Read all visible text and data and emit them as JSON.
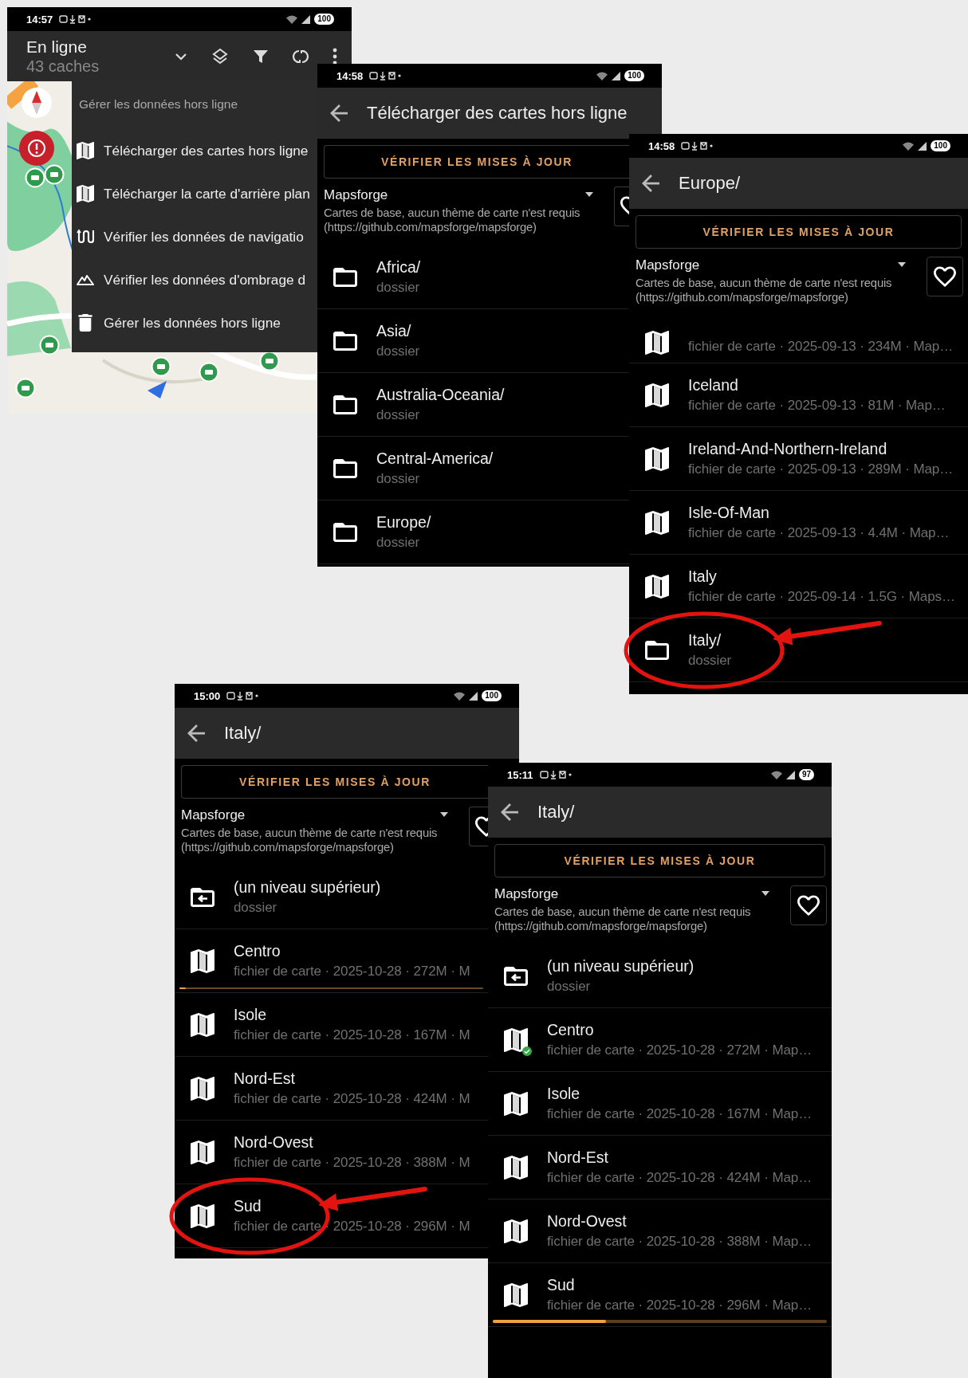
{
  "screens": [
    {
      "kind": "map_menu",
      "status": {
        "time": "14:57",
        "battery": "100"
      },
      "title": "En ligne",
      "subtitle": "43 caches",
      "menu": {
        "header": "Gérer les données hors ligne",
        "items": [
          {
            "kind": "map",
            "label": "Télécharger des cartes hors ligne"
          },
          {
            "kind": "map",
            "label": "Télécharger la carte d'arrière plan"
          },
          {
            "kind": "route",
            "label": "Vérifier les données de navigatio"
          },
          {
            "kind": "mountain",
            "label": "Vérifier les données d'ombrage d"
          },
          {
            "kind": "trash",
            "label": "Gérer les données hors ligne"
          }
        ]
      }
    },
    {
      "kind": "file_list",
      "status": {
        "time": "14:58",
        "battery": "100"
      },
      "title": "Télécharger des cartes hors ligne",
      "update_button": "VÉRIFIER LES MISES À JOUR",
      "source": {
        "name": "Mapsforge",
        "description": "Cartes de base, aucun thème de carte n'est requis",
        "url": "(https://github.com/mapsforge/mapsforge)"
      },
      "items": [
        {
          "kind": "folder",
          "name": "Africa/",
          "detail": "dossier",
          "downloaded": false,
          "circled": false
        },
        {
          "kind": "folder",
          "name": "Asia/",
          "detail": "dossier",
          "downloaded": false,
          "circled": false
        },
        {
          "kind": "folder",
          "name": "Australia-Oceania/",
          "detail": "dossier",
          "downloaded": false,
          "circled": false
        },
        {
          "kind": "folder",
          "name": "Central-America/",
          "detail": "dossier",
          "downloaded": false,
          "circled": false
        },
        {
          "kind": "folder",
          "name": "Europe/",
          "detail": "dossier",
          "downloaded": false,
          "circled": false
        }
      ]
    },
    {
      "kind": "file_list",
      "status": {
        "time": "14:58",
        "battery": "100"
      },
      "title": "Europe/",
      "update_button": "VÉRIFIER LES MISES À JOUR",
      "source": {
        "name": "Mapsforge",
        "description": "Cartes de base, aucun thème de carte n'est requis",
        "url": "(https://github.com/mapsforge/mapsforge)"
      },
      "items": [
        {
          "kind": "map",
          "detail": "fichier de carte · 2025-09-13 · 234M · Map…",
          "downloaded": false,
          "circled": false
        },
        {
          "kind": "map",
          "name": "Iceland",
          "detail": "fichier de carte · 2025-09-13 · 81M · Map…",
          "downloaded": false,
          "circled": false
        },
        {
          "kind": "map",
          "name": "Ireland-And-Northern-Ireland",
          "detail": "fichier de carte · 2025-09-13 · 289M · Map…",
          "downloaded": false,
          "circled": false
        },
        {
          "kind": "map",
          "name": "Isle-Of-Man",
          "detail": "fichier de carte · 2025-09-13 · 4.4M · Map…",
          "downloaded": false,
          "circled": false
        },
        {
          "kind": "map",
          "name": "Italy",
          "detail": "fichier de carte · 2025-09-14 · 1.5G · Maps…",
          "downloaded": false,
          "circled": false
        },
        {
          "kind": "folder",
          "name": "Italy/",
          "detail": "dossier",
          "downloaded": false,
          "circled": true
        }
      ]
    },
    {
      "kind": "file_list",
      "status": {
        "time": "15:00",
        "battery": "100"
      },
      "title": "Italy/",
      "update_button": "VÉRIFIER LES MISES À JOUR",
      "source": {
        "name": "Mapsforge",
        "description": "Cartes de base, aucun thème de carte n'est requis",
        "url": "(https://github.com/mapsforge/mapsforge)"
      },
      "items": [
        {
          "kind": "parent",
          "name": "(un niveau supérieur)",
          "detail": "dossier",
          "downloaded": false,
          "circled": false
        },
        {
          "kind": "map",
          "name": "Centro",
          "detail": "fichier de carte · 2025-10-28 · 272M · M",
          "downloaded": false,
          "circled": false,
          "level": 0.02
        },
        {
          "kind": "map",
          "name": "Isole",
          "detail": "fichier de carte · 2025-10-28 · 167M · M",
          "downloaded": false,
          "circled": false
        },
        {
          "kind": "map",
          "name": "Nord-Est",
          "detail": "fichier de carte · 2025-10-28 · 424M · M",
          "downloaded": false,
          "circled": false
        },
        {
          "kind": "map",
          "name": "Nord-Ovest",
          "detail": "fichier de carte · 2025-10-28 · 388M · M",
          "downloaded": false,
          "circled": false
        },
        {
          "kind": "map",
          "name": "Sud",
          "detail": "fichier de carte · 2025-10-28 · 296M · M",
          "downloaded": false,
          "circled": true
        }
      ]
    },
    {
      "kind": "file_list",
      "status": {
        "time": "15:11",
        "battery": "97"
      },
      "title": "Italy/",
      "update_button": "VÉRIFIER LES MISES À JOUR",
      "source": {
        "name": "Mapsforge",
        "description": "Cartes de base, aucun thème de carte n'est requis",
        "url": "(https://github.com/mapsforge/mapsforge)"
      },
      "items": [
        {
          "kind": "parent",
          "name": "(un niveau supérieur)",
          "detail": "dossier",
          "downloaded": false,
          "circled": false
        },
        {
          "kind": "map",
          "name": "Centro",
          "detail": "fichier de carte · 2025-10-28 · 272M · Map…",
          "downloaded": true,
          "circled": false
        },
        {
          "kind": "map",
          "name": "Isole",
          "detail": "fichier de carte · 2025-10-28 · 167M · Map…",
          "downloaded": false,
          "circled": false
        },
        {
          "kind": "map",
          "name": "Nord-Est",
          "detail": "fichier de carte · 2025-10-28 · 424M · Map…",
          "downloaded": false,
          "circled": false
        },
        {
          "kind": "map",
          "name": "Nord-Ovest",
          "detail": "fichier de carte · 2025-10-28 · 388M · Map…",
          "downloaded": false,
          "circled": false
        },
        {
          "kind": "map",
          "name": "Sud",
          "detail": "fichier de carte · 2025-10-28 · 296M · Map…",
          "downloaded": false,
          "circled": false,
          "level": 0.34
        }
      ]
    }
  ]
}
